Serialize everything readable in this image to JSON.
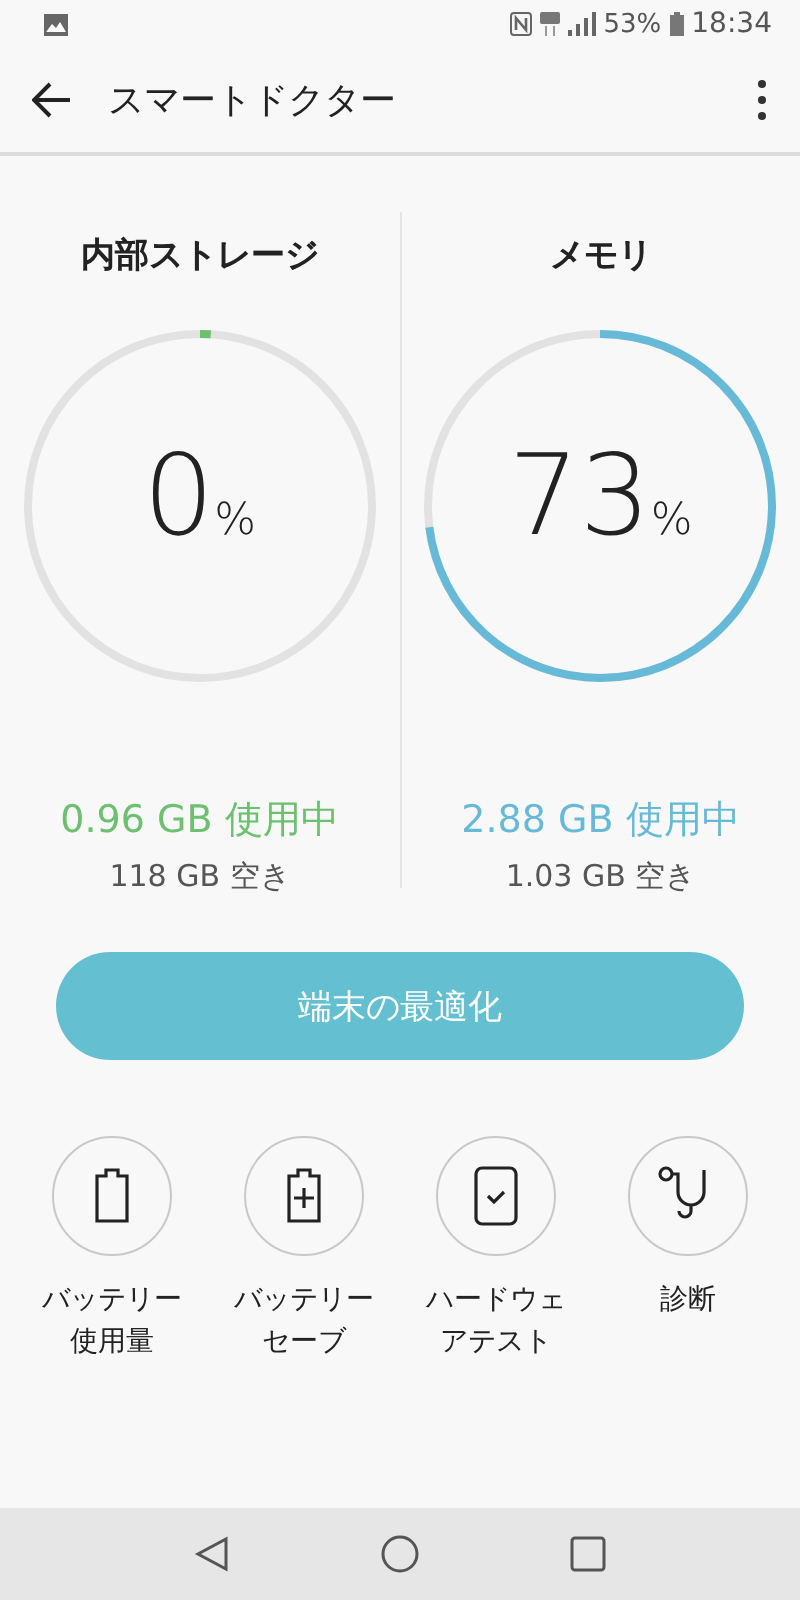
{
  "status_bar": {
    "battery": "53%",
    "time": "18:34"
  },
  "app_bar": {
    "title": "スマートドクター"
  },
  "gauges": [
    {
      "title": "内部ストレージ",
      "value": "0",
      "unit": "%",
      "level": 0.01,
      "color": "#6cc070",
      "used": "0.96 GB 使用中",
      "free": "118 GB 空き"
    },
    {
      "title": "メモリ",
      "value": "73",
      "unit": "%",
      "level": 0.73,
      "color": "#67b9d8",
      "used": "2.88 GB 使用中",
      "free": "1.03 GB 空き"
    }
  ],
  "optimize_button": {
    "label": "端末の最適化"
  },
  "tools": [
    {
      "kind": "battery",
      "label": "バッテリー使用量"
    },
    {
      "kind": "battery-plus",
      "label": "バッテリーセーブ"
    },
    {
      "kind": "phone-check",
      "label": "ハードウェアテスト"
    },
    {
      "kind": "stethoscope",
      "label": "診断"
    }
  ]
}
